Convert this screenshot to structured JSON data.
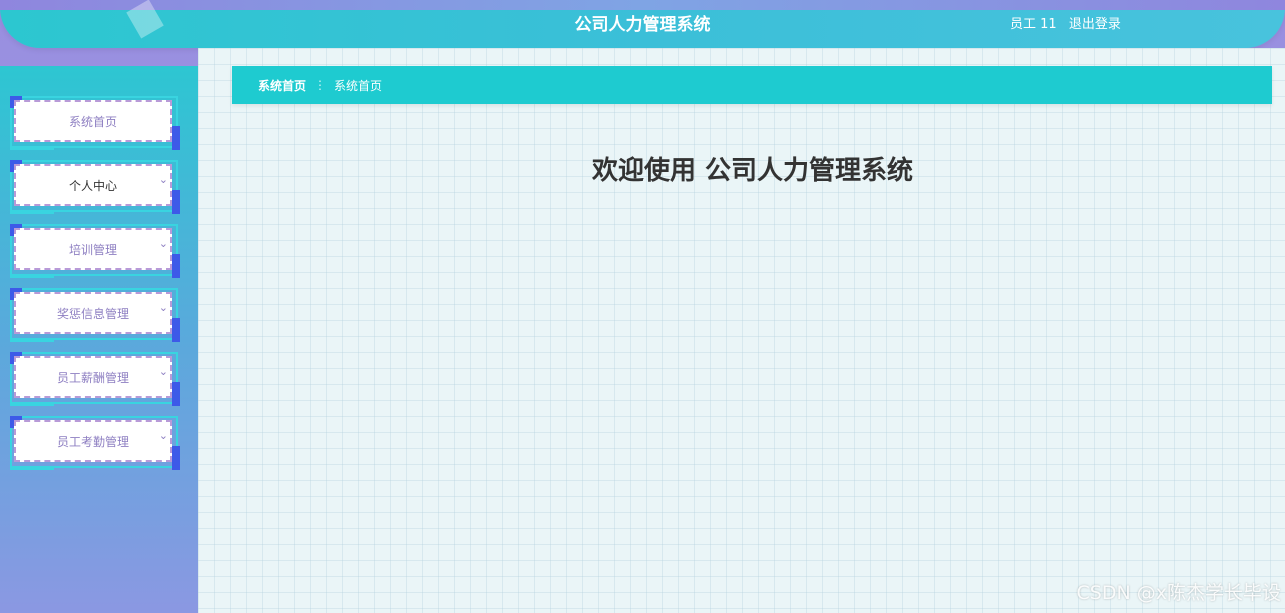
{
  "header": {
    "title": "公司人力管理系统",
    "user_label": "员工 11",
    "logout_label": "退出登录"
  },
  "sidebar": {
    "items": [
      {
        "label": "系统首页",
        "has_chevron": false
      },
      {
        "label": "个人中心",
        "has_chevron": true
      },
      {
        "label": "培训管理",
        "has_chevron": true
      },
      {
        "label": "奖惩信息管理",
        "has_chevron": true
      },
      {
        "label": "员工薪酬管理",
        "has_chevron": true
      },
      {
        "label": "员工考勤管理",
        "has_chevron": true
      }
    ]
  },
  "breadcrumb": {
    "home": "系统首页",
    "separator": "⋮",
    "current": "系统首页"
  },
  "main": {
    "welcome": "欢迎使用 公司人力管理系统"
  },
  "watermark": "CSDN @x陈杰学长毕设",
  "icons": {
    "chevron": "chevron-down-icon"
  },
  "colors": {
    "accent": "#1ecbd0",
    "corner": "#3d5ae8"
  }
}
